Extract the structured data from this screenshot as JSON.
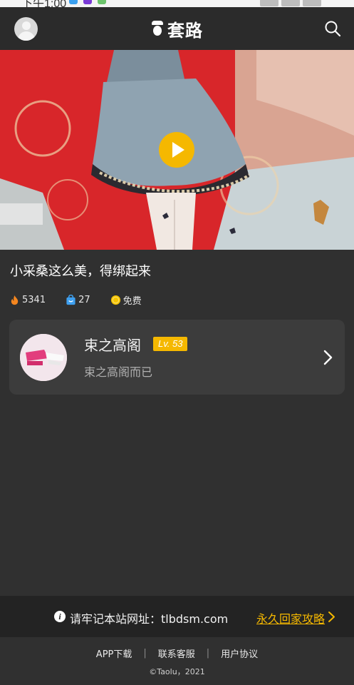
{
  "status_bar": {
    "time": "下午1:00"
  },
  "header": {
    "avatar_icon": "user-avatar-icon",
    "logo_icon": "monkey-logo-icon",
    "title": "套路",
    "search_icon": "search-icon"
  },
  "video": {
    "play_icon": "play-icon",
    "title": "小采桑这么美，得绑起来"
  },
  "stats": {
    "views_icon": "flame-icon",
    "views": "5341",
    "favorites_icon": "bag-icon",
    "favorites": "27",
    "price_icon": "coin-icon",
    "price": "免费"
  },
  "author": {
    "name": "束之高阁",
    "level": "Lv. 53",
    "bio": "束之高阁而已",
    "chevron_icon": "chevron-right-icon"
  },
  "notice": {
    "info_icon": "info-icon",
    "info_glyph": "i",
    "text": "请牢记本站网址：tlbdsm.com",
    "link": "永久回家攻略"
  },
  "footer": {
    "links": [
      "APP下载",
      "联系客服",
      "用户协议"
    ],
    "separator": "|",
    "copyright": "©Taolu，2021"
  },
  "colors": {
    "accent": "#f5b800",
    "background": "#303030",
    "header_bg": "#2b2b2b",
    "card_bg": "#3c3c3c"
  }
}
